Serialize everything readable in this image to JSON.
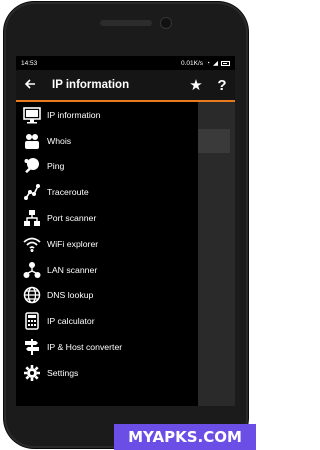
{
  "status_bar": {
    "time": "14:53",
    "network_speed": "0.01K/s"
  },
  "app_bar": {
    "back_icon": "arrow-back-icon",
    "title": "IP information",
    "favorite_icon": "star-icon",
    "help_label": "?"
  },
  "content": {
    "card_text": "··"
  },
  "drawer": {
    "items": [
      {
        "label": "IP information",
        "icon": "monitor-icon"
      },
      {
        "label": "Whois",
        "icon": "users-icon"
      },
      {
        "label": "Ping",
        "icon": "ping-pong-icon"
      },
      {
        "label": "Traceroute",
        "icon": "route-icon"
      },
      {
        "label": "Port scanner",
        "icon": "network-icon"
      },
      {
        "label": "WiFi explorer",
        "icon": "wifi-icon"
      },
      {
        "label": "LAN scanner",
        "icon": "lan-icon"
      },
      {
        "label": "DNS lookup",
        "icon": "globe-icon"
      },
      {
        "label": "IP calculator",
        "icon": "calculator-icon"
      },
      {
        "label": "IP & Host converter",
        "icon": "signpost-icon"
      },
      {
        "label": "Settings",
        "icon": "gear-icon"
      }
    ]
  },
  "watermark": "MYAPKS.COM",
  "colors": {
    "accent": "#e87b1e",
    "drawer_bg": "#000000",
    "appbar_bg": "#151515",
    "watermark_bg": "#6b4ee6"
  }
}
